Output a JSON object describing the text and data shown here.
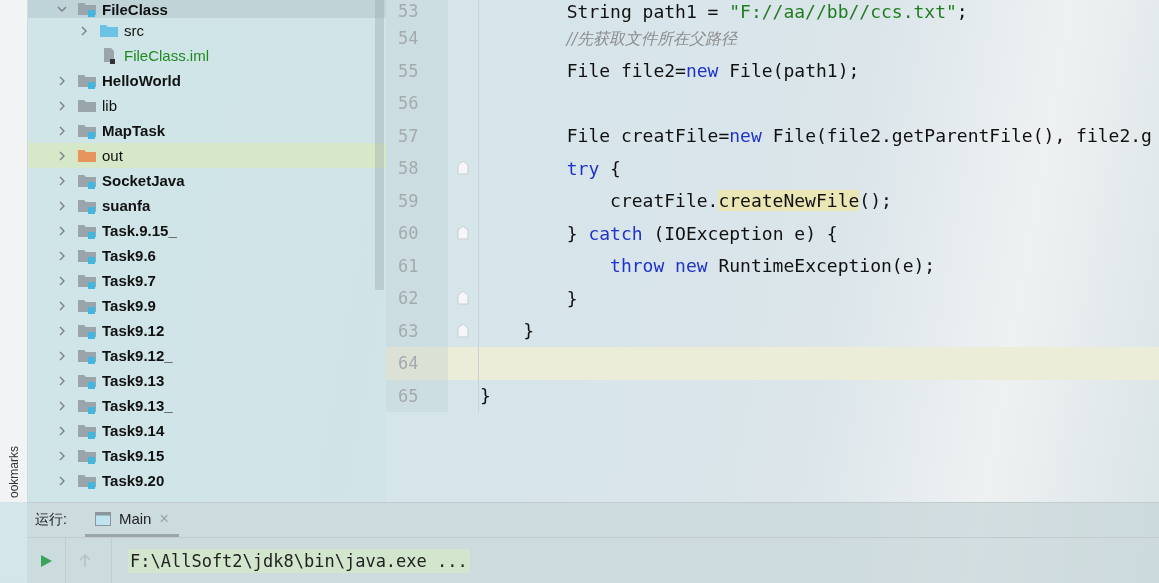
{
  "side_strip": {
    "label": "ookmarks"
  },
  "project_tree": [
    {
      "label": "FileClass",
      "kind": "module",
      "expanded": true,
      "selected": false,
      "children": [
        {
          "label": "src",
          "kind": "source",
          "expanded": false,
          "selected": false
        },
        {
          "label": "FileClass.iml",
          "kind": "file",
          "selected": false
        }
      ]
    },
    {
      "label": "HelloWorld",
      "kind": "module",
      "expanded": false,
      "selected": false
    },
    {
      "label": "lib",
      "kind": "folder",
      "expanded": false,
      "selected": false
    },
    {
      "label": "MapTask",
      "kind": "module",
      "expanded": false,
      "selected": false
    },
    {
      "label": "out",
      "kind": "output",
      "expanded": false,
      "selected": true
    },
    {
      "label": "SocketJava",
      "kind": "module",
      "expanded": false,
      "selected": false
    },
    {
      "label": "suanfa",
      "kind": "module",
      "expanded": false,
      "selected": false
    },
    {
      "label": "Task.9.15_",
      "kind": "module",
      "expanded": false,
      "selected": false
    },
    {
      "label": "Task9.6",
      "kind": "module",
      "expanded": false,
      "selected": false
    },
    {
      "label": "Task9.7",
      "kind": "module",
      "expanded": false,
      "selected": false
    },
    {
      "label": "Task9.9",
      "kind": "module",
      "expanded": false,
      "selected": false
    },
    {
      "label": "Task9.12",
      "kind": "module",
      "expanded": false,
      "selected": false
    },
    {
      "label": "Task9.12_",
      "kind": "module",
      "expanded": false,
      "selected": false
    },
    {
      "label": "Task9.13",
      "kind": "module",
      "expanded": false,
      "selected": false
    },
    {
      "label": "Task9.13_",
      "kind": "module",
      "expanded": false,
      "selected": false
    },
    {
      "label": "Task9.14",
      "kind": "module",
      "expanded": false,
      "selected": false
    },
    {
      "label": "Task9.15",
      "kind": "module",
      "expanded": false,
      "selected": false
    },
    {
      "label": "Task9.20",
      "kind": "module",
      "expanded": false,
      "selected": false
    }
  ],
  "editor": {
    "lines": [
      {
        "number": "53",
        "current": false,
        "fold_marker": false,
        "segments": [
          {
            "kind": "plain",
            "text": "        String path1 = "
          },
          {
            "kind": "string",
            "text": "\"F://aa//bb//ccs.txt\""
          },
          {
            "kind": "plain",
            "text": ";"
          }
        ]
      },
      {
        "number": "54",
        "current": false,
        "fold_marker": false,
        "segments": [
          {
            "kind": "comment",
            "text": "        //先获取文件所在父路径"
          }
        ]
      },
      {
        "number": "55",
        "current": false,
        "fold_marker": false,
        "segments": [
          {
            "kind": "plain",
            "text": "        File file2="
          },
          {
            "kind": "keyword",
            "text": "new"
          },
          {
            "kind": "plain",
            "text": " File(path1);"
          }
        ]
      },
      {
        "number": "56",
        "current": false,
        "fold_marker": false
      },
      {
        "number": "57",
        "current": false,
        "fold_marker": false,
        "segments": [
          {
            "kind": "plain",
            "text": "        File creatFile="
          },
          {
            "kind": "keyword",
            "text": "new"
          },
          {
            "kind": "plain",
            "text": " File(file2.getParentFile(), file2.g"
          }
        ]
      },
      {
        "number": "58",
        "current": false,
        "fold_marker": true,
        "segments": [
          {
            "kind": "keyword",
            "text": "        try"
          },
          {
            "kind": "plain",
            "text": " {"
          }
        ]
      },
      {
        "number": "59",
        "current": false,
        "fold_marker": false,
        "segments": [
          {
            "kind": "plain",
            "text": "            creatFile."
          },
          {
            "kind": "highlight",
            "text": "createNewFile"
          },
          {
            "kind": "plain",
            "text": "();"
          }
        ]
      },
      {
        "number": "60",
        "current": false,
        "fold_marker": true,
        "segments": [
          {
            "kind": "plain",
            "text": "        } "
          },
          {
            "kind": "keyword",
            "text": "catch"
          },
          {
            "kind": "plain",
            "text": " (IOException e) {"
          }
        ]
      },
      {
        "number": "61",
        "current": false,
        "fold_marker": false,
        "segments": [
          {
            "kind": "keyword",
            "text": "            throw new"
          },
          {
            "kind": "plain",
            "text": " RuntimeException(e);"
          }
        ]
      },
      {
        "number": "62",
        "current": false,
        "fold_marker": true,
        "segments": [
          {
            "kind": "plain",
            "text": "        }"
          }
        ]
      },
      {
        "number": "63",
        "current": false,
        "fold_marker": true,
        "segments": [
          {
            "kind": "plain",
            "text": "    }"
          }
        ]
      },
      {
        "number": "64",
        "current": true,
        "fold_marker": false
      },
      {
        "number": "65",
        "current": false,
        "fold_marker": false,
        "segments": [
          {
            "kind": "plain",
            "text": "}"
          }
        ]
      }
    ]
  },
  "run_panel": {
    "label": "运行:",
    "tabs": [
      {
        "label": "Main",
        "selected": true,
        "closable": "×"
      }
    ],
    "console_lines": [
      "F:\\AllSoft2\\jdk8\\bin\\java.exe ..."
    ]
  }
}
